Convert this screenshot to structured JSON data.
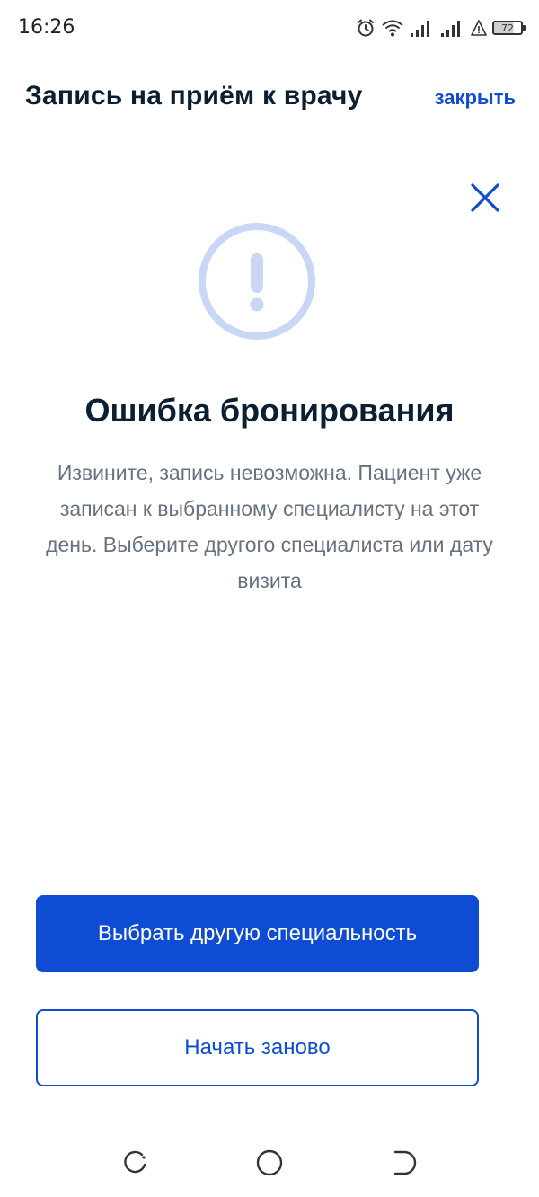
{
  "status_bar": {
    "time": "16:26",
    "battery_level": "72",
    "icons": [
      "alarm-icon",
      "wifi-icon",
      "signal-icon",
      "signal-icon",
      "warning-icon",
      "battery-icon"
    ]
  },
  "header": {
    "title": "Запись на приём к врачу",
    "close_label": "закрыть"
  },
  "dialog": {
    "icon": "exclamation-circle-icon",
    "title": "Ошибка бронирования",
    "message": "Извините, запись невозможна. Пациент уже записан к выбранному специалисту на этот день. Выберите другого специалиста или дату визита"
  },
  "actions": {
    "primary_label": "Выбрать другую специальность",
    "secondary_label": "Начать заново"
  },
  "nav_bar": {
    "items": [
      "recents-icon",
      "home-icon",
      "back-icon"
    ]
  },
  "colors": {
    "accent": "#0d4cd3",
    "title_text": "#0b1f33",
    "body_text": "#66727f",
    "icon_light": "#c9d6f5"
  }
}
